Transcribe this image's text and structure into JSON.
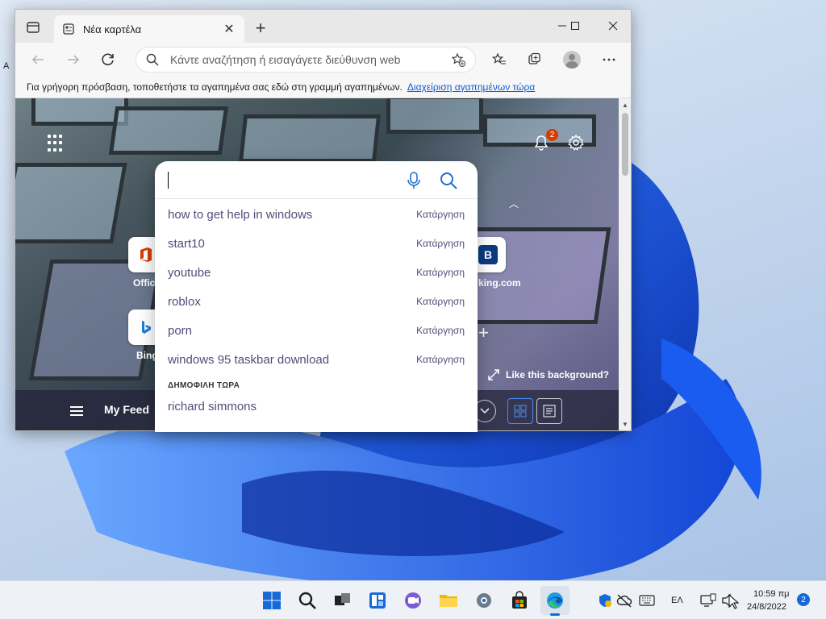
{
  "desktop": {
    "label": "A"
  },
  "window": {
    "tab_title": "Νέα καρτέλα",
    "address_placeholder": "Κάντε αναζήτηση ή εισαγάγετε διεύθυνση web",
    "favorites_bar_text": "Για γρήγορη πρόσβαση, τοποθετήστε τα αγαπημένα σας εδώ στη γραμμή αγαπημένων.",
    "favorites_bar_link": "Διαχείριση αγαπημένων τώρα"
  },
  "ntp": {
    "notification_count": "2",
    "tiles": [
      {
        "label": "Office",
        "icon": "office-icon"
      },
      {
        "label": "Bing",
        "icon": "bing-icon"
      },
      {
        "label": "king.com",
        "icon": "booking-icon",
        "letter": "B"
      }
    ],
    "like_background": "Like this background?",
    "my_feed": "My Feed"
  },
  "search": {
    "suggestions": [
      {
        "text": "how to get help in windows",
        "remove": "Κατάργηση"
      },
      {
        "text": "start10",
        "remove": "Κατάργηση"
      },
      {
        "text": "youtube",
        "remove": "Κατάργηση"
      },
      {
        "text": "roblox",
        "remove": "Κατάργηση"
      },
      {
        "text": "porn",
        "remove": "Κατάργηση"
      },
      {
        "text": "windows 95 taskbar download",
        "remove": "Κατάργηση"
      }
    ],
    "trending_heading": "ΔΗΜΟΦΙΛΗ ΤΩΡΑ",
    "trending": [
      "richard simmons"
    ]
  },
  "taskbar": {
    "language": "ΕΛ",
    "time": "10:59 πμ",
    "date": "24/8/2022",
    "notification_count": "2"
  },
  "colors": {
    "accent": "#1669d8",
    "badge": "#d83b01",
    "link": "#0b5cd5"
  }
}
